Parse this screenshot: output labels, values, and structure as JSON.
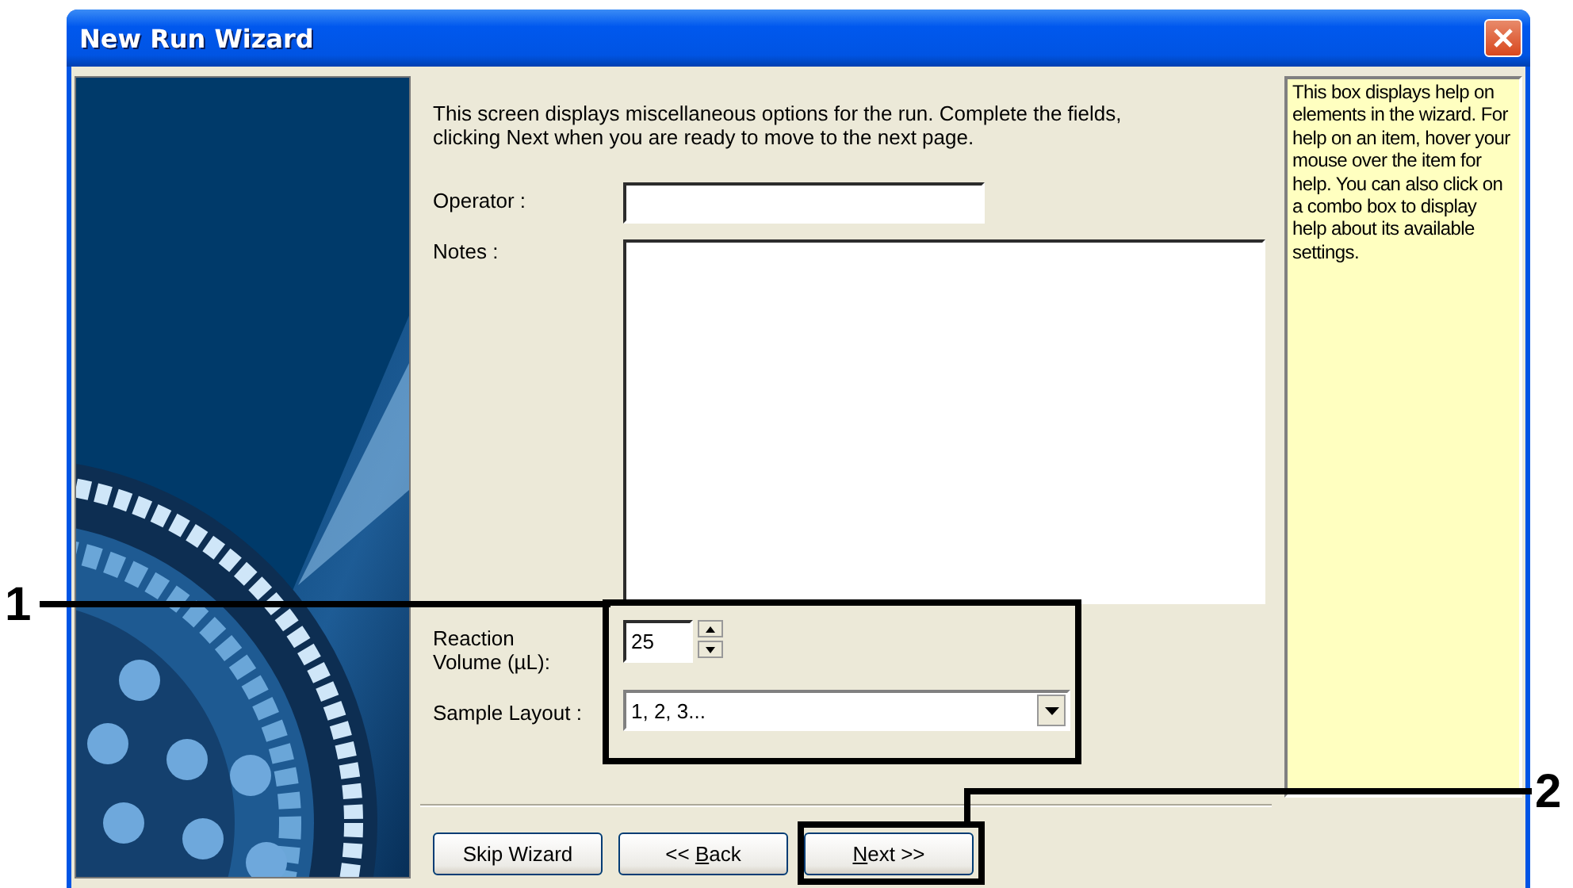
{
  "window": {
    "title": "New Run Wizard"
  },
  "intro": "This screen displays miscellaneous options for the run. Complete the fields, clicking Next when you are ready to move to the next page.",
  "fields": [
    {
      "kind": "text",
      "label": "Operator :"
    },
    {
      "kind": "memo",
      "label": "Notes :"
    },
    {
      "kind": "spin",
      "label": "Reaction Volume (µL):",
      "value": "25"
    },
    {
      "kind": "combo",
      "label": "Sample Layout :",
      "value": "1, 2, 3..."
    }
  ],
  "help": "This box displays help on elements in the wizard. For help on an item, hover your mouse over the item for help. You can also click on a combo box to display help about its available settings.",
  "buttons": [
    {
      "pre": "Skip Wizard"
    },
    {
      "pre": "<< ",
      "key": "B",
      "post": "ack"
    },
    {
      "key": "N",
      "post": "ext >>"
    }
  ],
  "callouts": [
    {
      "number": "1"
    },
    {
      "number": "2"
    }
  ]
}
